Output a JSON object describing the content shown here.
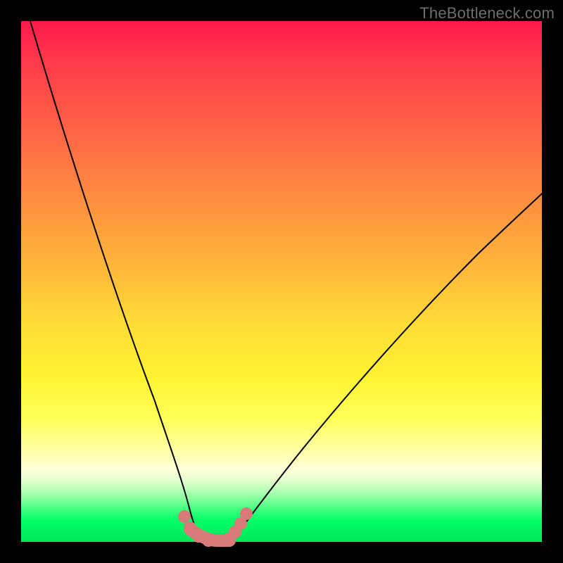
{
  "watermark": "TheBottleneck.com",
  "chart_data": {
    "type": "line",
    "title": "",
    "xlabel": "",
    "ylabel": "",
    "xlim": [
      0,
      100
    ],
    "ylim": [
      0,
      100
    ],
    "grid": false,
    "legend": false,
    "series": [
      {
        "name": "left-curve",
        "x": [
          0,
          5,
          10,
          15,
          20,
          25,
          27,
          29,
          31,
          33
        ],
        "y": [
          100,
          80,
          60,
          42,
          26,
          12,
          7,
          3,
          1,
          0
        ]
      },
      {
        "name": "right-curve",
        "x": [
          37,
          40,
          45,
          50,
          55,
          60,
          70,
          80,
          90,
          100
        ],
        "y": [
          0,
          2,
          7,
          13,
          19,
          25,
          37,
          48,
          58,
          67
        ]
      }
    ],
    "marked_points": {
      "name": "bottom-dots",
      "color": "#d97a7a",
      "x": [
        29,
        30,
        31.5,
        33,
        34.5,
        36,
        37,
        38.5,
        40,
        41.5
      ],
      "y": [
        4,
        2,
        0.5,
        0,
        0,
        0,
        0.5,
        2,
        3.5,
        5.5
      ]
    }
  }
}
